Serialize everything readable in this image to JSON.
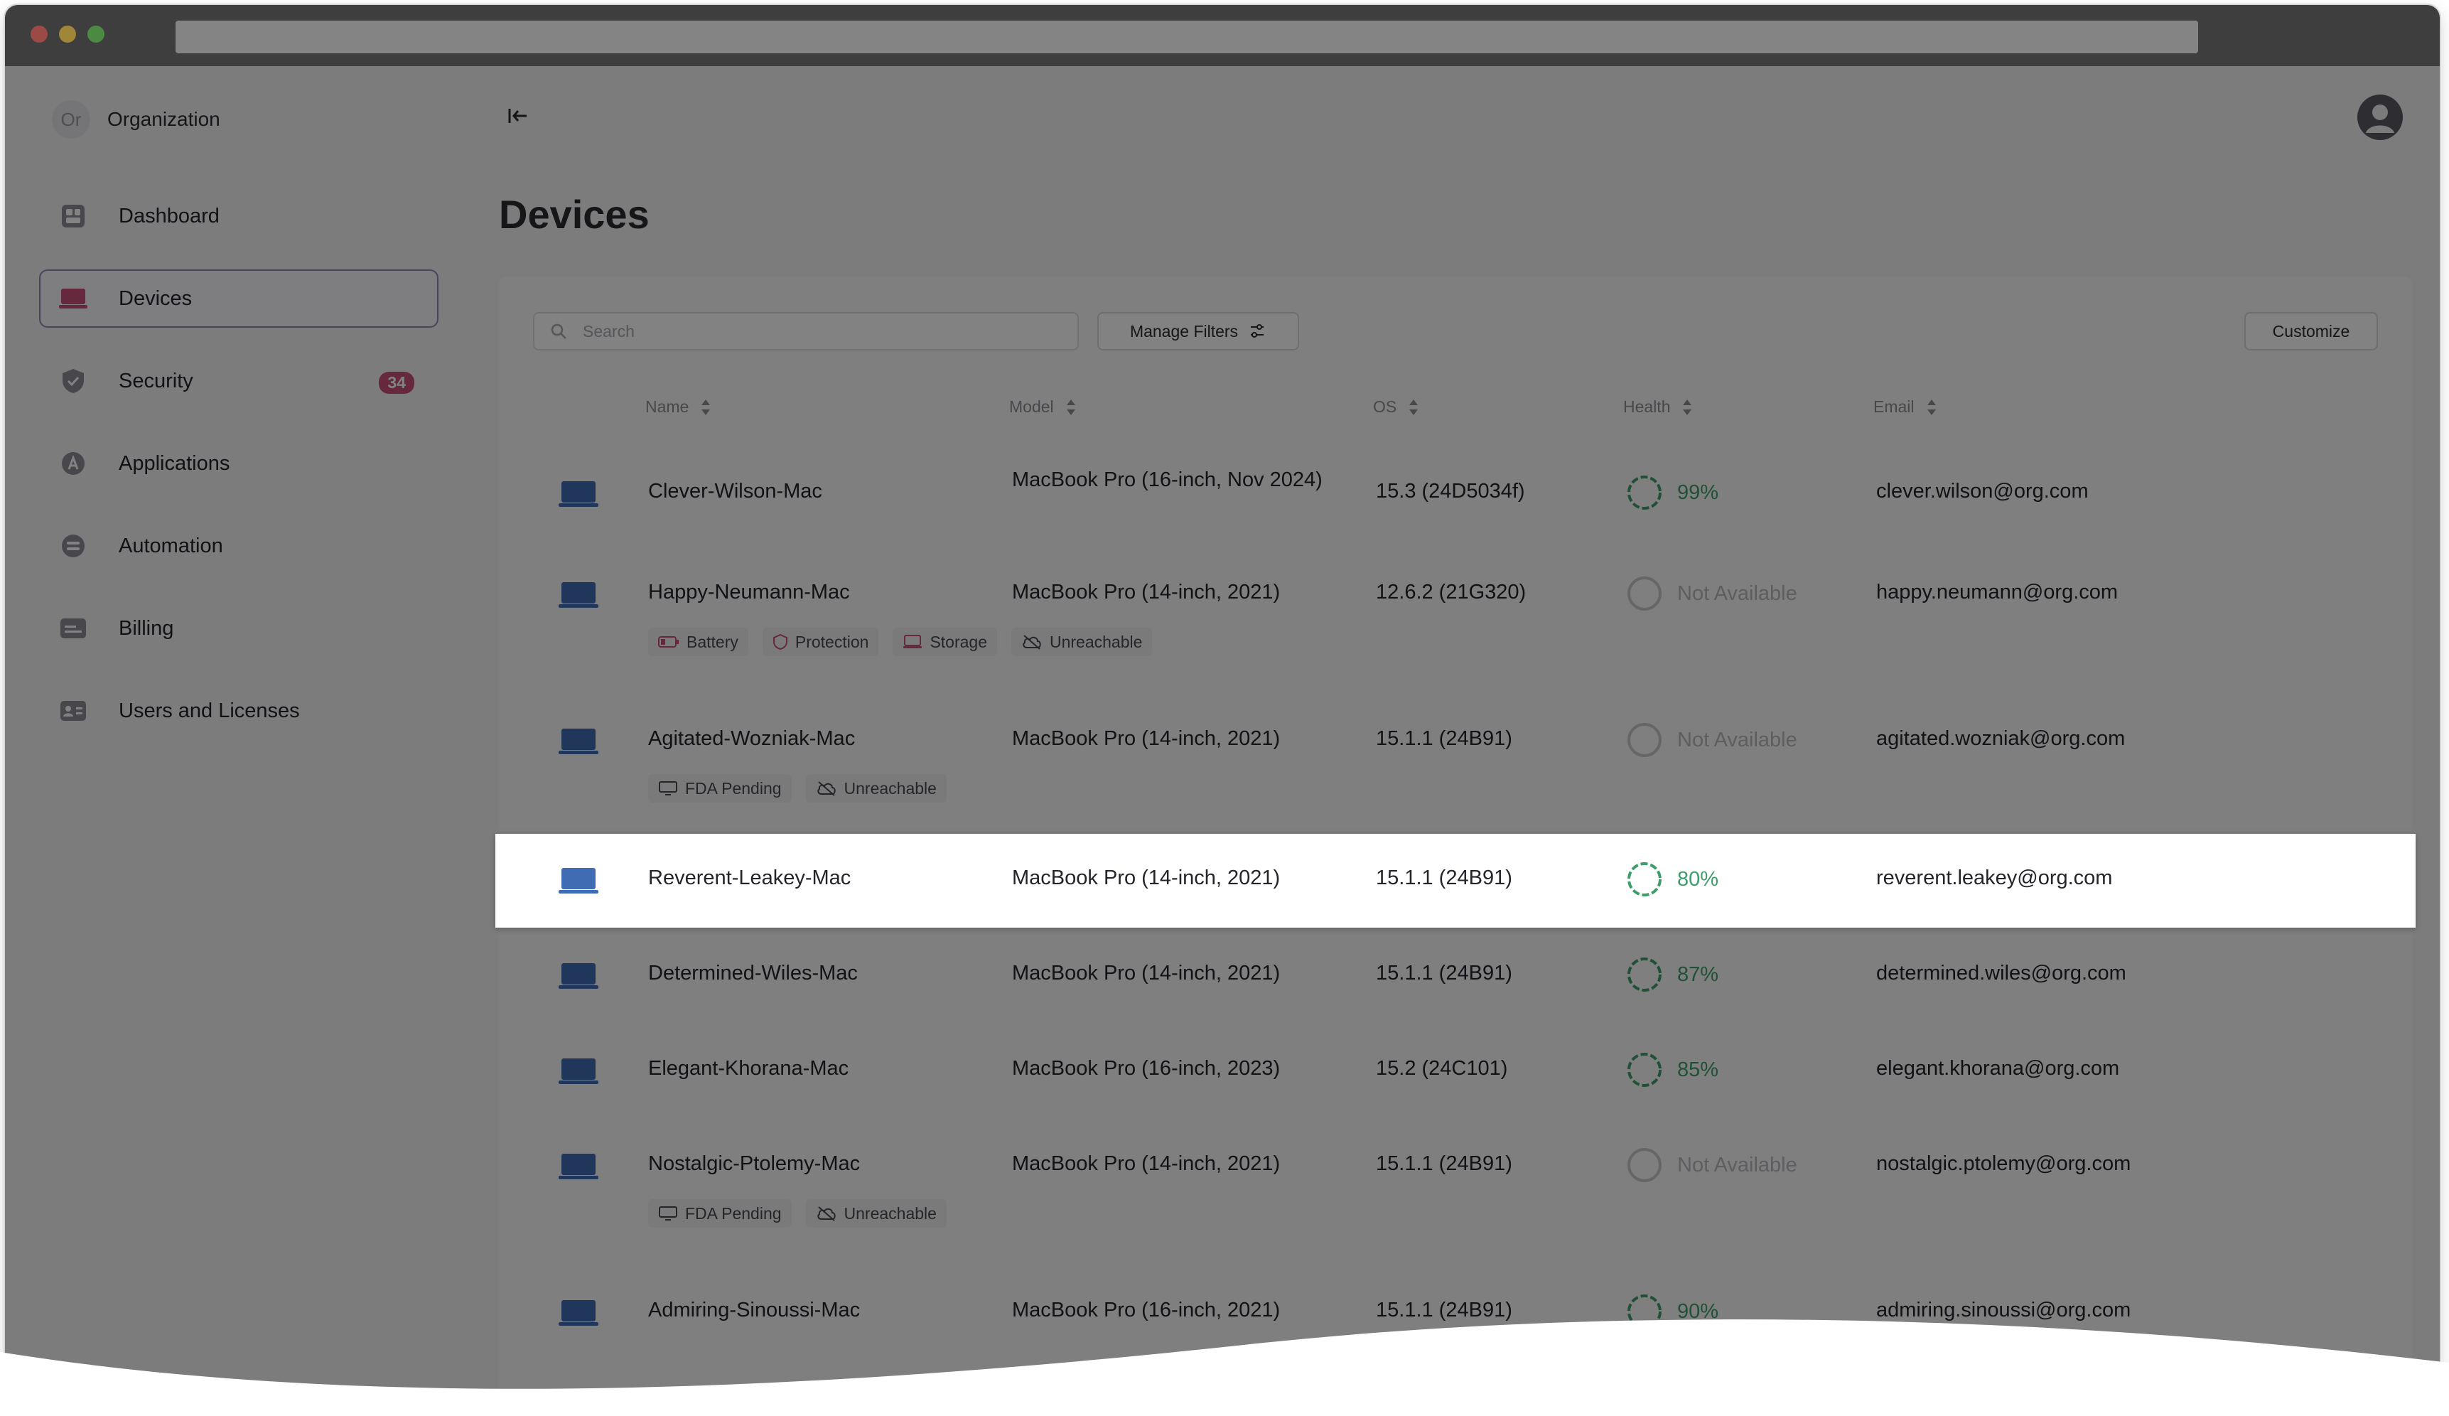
{
  "org": {
    "initials": "Or",
    "name": "Organization"
  },
  "nav": [
    {
      "label": "Dashboard",
      "icon": "dashboard-icon"
    },
    {
      "label": "Devices",
      "icon": "devices-icon",
      "active": true
    },
    {
      "label": "Security",
      "icon": "shield-icon",
      "badge": "34"
    },
    {
      "label": "Applications",
      "icon": "app-store-icon"
    },
    {
      "label": "Automation",
      "icon": "automation-icon"
    },
    {
      "label": "Billing",
      "icon": "billing-icon"
    },
    {
      "label": "Users and Licenses",
      "icon": "users-icon"
    }
  ],
  "page": {
    "title": "Devices"
  },
  "toolbar": {
    "search_placeholder": "Search",
    "manage_filters": "Manage Filters",
    "customize": "Customize"
  },
  "columns": {
    "name": "Name",
    "model": "Model",
    "os": "OS",
    "health": "Health",
    "email": "Email"
  },
  "colors": {
    "health_good": "#3f9d6a",
    "badge": "#c74f77",
    "active_border": "#8e88b8"
  },
  "devices": [
    {
      "name": "Clever-Wilson-Mac",
      "model": "MacBook Pro (16-inch, Nov 2024)",
      "os": "15.3 (24D5034f)",
      "health": "99%",
      "email": "clever.wilson@org.com",
      "chips": []
    },
    {
      "name": "Happy-Neumann-Mac",
      "model": "MacBook Pro (14-inch, 2021)",
      "os": "12.6.2 (21G320)",
      "health": "Not Available",
      "email": "happy.neumann@org.com",
      "chips": [
        "Battery",
        "Protection",
        "Storage",
        "Unreachable"
      ]
    },
    {
      "name": "Agitated-Wozniak-Mac",
      "model": "MacBook Pro (14-inch, 2021)",
      "os": "15.1.1 (24B91)",
      "health": "Not Available",
      "email": "agitated.wozniak@org.com",
      "chips": [
        "FDA Pending",
        "Unreachable"
      ]
    },
    {
      "name": "Reverent-Leakey-Mac",
      "model": "MacBook Pro (14-inch, 2021)",
      "os": "15.1.1 (24B91)",
      "health": "80%",
      "email": "reverent.leakey@org.com",
      "chips": [],
      "selected": true
    },
    {
      "name": "Determined-Wiles-Mac",
      "model": "MacBook Pro (14-inch, 2021)",
      "os": "15.1.1 (24B91)",
      "health": "87%",
      "email": "determined.wiles@org.com",
      "chips": []
    },
    {
      "name": "Elegant-Khorana-Mac",
      "model": "MacBook Pro (16-inch, 2023)",
      "os": "15.2 (24C101)",
      "health": "85%",
      "email": "elegant.khorana@org.com",
      "chips": []
    },
    {
      "name": "Nostalgic-Ptolemy-Mac",
      "model": "MacBook Pro (14-inch, 2021)",
      "os": "15.1.1 (24B91)",
      "health": "Not Available",
      "email": "nostalgic.ptolemy@org.com",
      "chips": [
        "FDA Pending",
        "Unreachable"
      ]
    },
    {
      "name": "Admiring-Sinoussi-Mac",
      "model": "MacBook Pro (16-inch, 2021)",
      "os": "15.1.1 (24B91)",
      "health": "90%",
      "email": "admiring.sinoussi@org.com",
      "chips": []
    }
  ]
}
